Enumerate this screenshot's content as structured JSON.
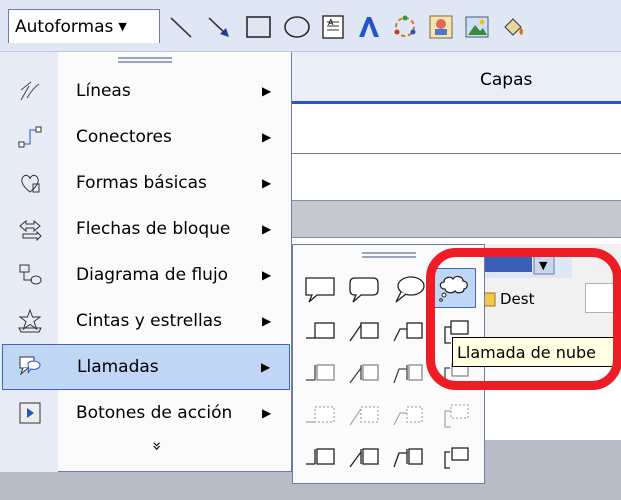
{
  "toolbar": {
    "autoformas_label": "Autoformas",
    "icons": [
      "line-icon",
      "arrow-icon",
      "rectangle-icon",
      "oval-icon",
      "textbox-icon",
      "wordart-icon",
      "diagram-icon",
      "clipart-icon",
      "picture-icon",
      "fill-color-icon"
    ]
  },
  "background": {
    "layers_label": "Capas",
    "dest_label": "Dest"
  },
  "menu": {
    "items": [
      {
        "label": "Líneas",
        "icon": "lines-icon"
      },
      {
        "label": "Conectores",
        "icon": "connectors-icon"
      },
      {
        "label": "Formas básicas",
        "icon": "basic-shapes-icon"
      },
      {
        "label": "Flechas de bloque",
        "icon": "block-arrows-icon"
      },
      {
        "label": "Diagrama de flujo",
        "icon": "flowchart-icon"
      },
      {
        "label": "Cintas y estrellas",
        "icon": "stars-banners-icon"
      },
      {
        "label": "Llamadas",
        "icon": "callouts-icon",
        "selected": true
      },
      {
        "label": "Botones de acción",
        "icon": "action-buttons-icon"
      }
    ],
    "expand_glyph": "»"
  },
  "tooltip": {
    "text": "Llamada de nube"
  },
  "colors": {
    "highlight": "#ee1c24",
    "selection": "#c0d6f5",
    "selection_border": "#3b67c3"
  }
}
